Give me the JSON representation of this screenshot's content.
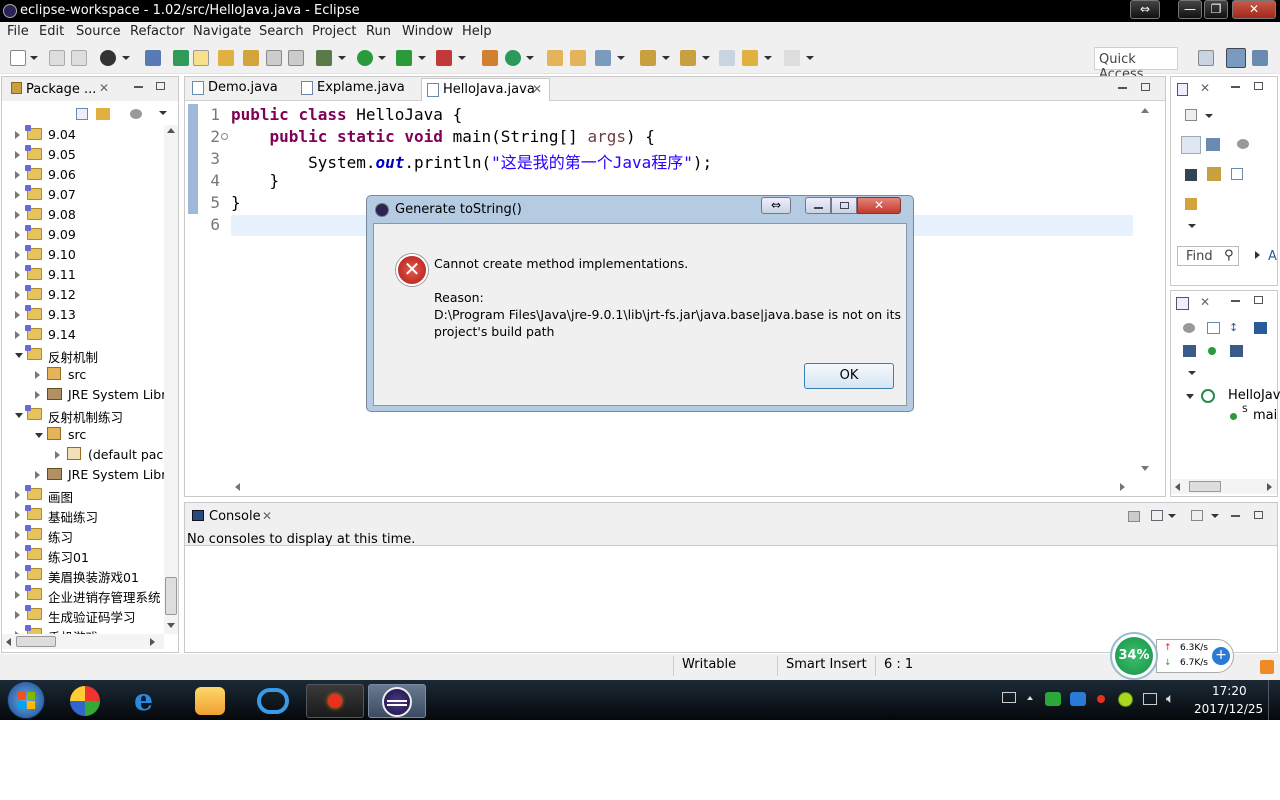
{
  "window": {
    "title": "eclipse-workspace - 1.02/src/HelloJava.java - Eclipse",
    "close_glyph": "✕",
    "min_glyph": "—",
    "max_glyph": "❐",
    "resize_glyph": "⇔"
  },
  "menu": [
    "File",
    "Edit",
    "Source",
    "Refactor",
    "Navigate",
    "Search",
    "Project",
    "Run",
    "Window",
    "Help"
  ],
  "toolbar": {
    "quick_access": "Quick Access"
  },
  "package_explorer": {
    "title": "Package ...",
    "items": [
      {
        "label": "9.04",
        "type": "project",
        "state": "closed",
        "indent": 0
      },
      {
        "label": "9.05",
        "type": "project",
        "state": "closed",
        "indent": 0
      },
      {
        "label": "9.06",
        "type": "project",
        "state": "closed",
        "indent": 0
      },
      {
        "label": "9.07",
        "type": "project",
        "state": "closed",
        "indent": 0
      },
      {
        "label": "9.08",
        "type": "project",
        "state": "closed",
        "indent": 0
      },
      {
        "label": "9.09",
        "type": "project",
        "state": "closed",
        "indent": 0
      },
      {
        "label": "9.10",
        "type": "project",
        "state": "closed",
        "indent": 0
      },
      {
        "label": "9.11",
        "type": "project",
        "state": "closed",
        "indent": 0
      },
      {
        "label": "9.12",
        "type": "project",
        "state": "closed",
        "indent": 0
      },
      {
        "label": "9.13",
        "type": "project",
        "state": "closed",
        "indent": 0
      },
      {
        "label": "9.14",
        "type": "project",
        "state": "closed",
        "indent": 0
      },
      {
        "label": "反射机制",
        "type": "project",
        "state": "open",
        "indent": 0
      },
      {
        "label": "src",
        "type": "srcfolder",
        "state": "closed",
        "indent": 1
      },
      {
        "label": "JRE System Library",
        "type": "library",
        "state": "closed",
        "indent": 1
      },
      {
        "label": "反射机制练习",
        "type": "project",
        "state": "open",
        "indent": 0
      },
      {
        "label": "src",
        "type": "srcfolder",
        "state": "open",
        "indent": 1
      },
      {
        "label": "(default package)",
        "type": "package",
        "state": "closed",
        "indent": 2
      },
      {
        "label": "JRE System Library",
        "type": "library",
        "state": "closed",
        "indent": 1
      },
      {
        "label": "画图",
        "type": "project",
        "state": "closed",
        "indent": 0
      },
      {
        "label": "基础练习",
        "type": "project",
        "state": "closed",
        "indent": 0
      },
      {
        "label": "练习",
        "type": "project",
        "state": "closed",
        "indent": 0
      },
      {
        "label": "练习01",
        "type": "project",
        "state": "closed",
        "indent": 0
      },
      {
        "label": "美眉换装游戏01",
        "type": "project",
        "state": "closed",
        "indent": 0
      },
      {
        "label": "企业进销存管理系统",
        "type": "project",
        "state": "closed",
        "indent": 0
      },
      {
        "label": "生成验证码学习",
        "type": "project",
        "state": "closed",
        "indent": 0
      },
      {
        "label": "手机游戏",
        "type": "project",
        "state": "closed",
        "indent": 0
      }
    ]
  },
  "editor": {
    "tabs": [
      {
        "label": "Demo.java",
        "active": false
      },
      {
        "label": "Explame.java",
        "active": false
      },
      {
        "label": "HelloJava.java",
        "active": true
      }
    ],
    "line_numbers": [
      "1",
      "2",
      "3",
      "4",
      "5",
      "6"
    ]
  },
  "dialog": {
    "title": "Generate toString()",
    "message": "Cannot create method implementations.",
    "reason_label": "Reason:",
    "reason_line1": "D:\\Program Files\\Java\\jre-9.0.1\\lib\\jrt-fs.jar\\java.base|java.base is not on its",
    "reason_line2": "project's build path",
    "ok_label": "OK"
  },
  "outline": {
    "find_placeholder": "Find",
    "find_extra": "A",
    "class_label": "HelloJav",
    "method_label": "mai"
  },
  "console": {
    "title": "Console",
    "message": "No consoles to display at this time."
  },
  "statusbar": {
    "writable": "Writable",
    "insert_mode": "Smart Insert",
    "position": "6 : 1"
  },
  "netmeter": {
    "percent": "34%",
    "up": "6.3K/s",
    "down": "6.7K/s"
  },
  "taskbar": {
    "time": "17:20",
    "date": "2017/12/25"
  },
  "colors": {
    "accent": "#3c7fb1",
    "error": "#c0282a",
    "keyword": "#7f0055",
    "string": "#2a00ff"
  }
}
